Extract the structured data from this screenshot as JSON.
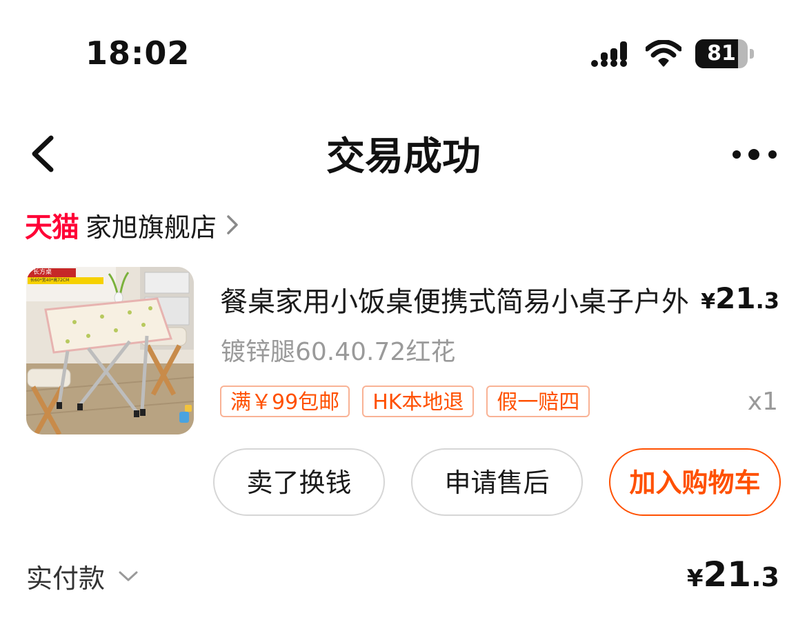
{
  "status_bar": {
    "time": "18:02",
    "battery": "81",
    "battery_level": 0.81
  },
  "nav": {
    "title": "交易成功",
    "back_icon": "chevron-left-icon",
    "more_icon": "more-dots-icon"
  },
  "store": {
    "platform": "天猫",
    "name": "家旭旗舰店",
    "platform_color": "#ff0036"
  },
  "product": {
    "thumbnail_label": "长方桌",
    "thumbnail_dimensions": "长60*宽40*高72CM",
    "title": "餐桌家用小饭桌便携式简易小桌子户外",
    "price_symbol": "¥",
    "price_int": "21",
    "price_dec": ".3",
    "spec": "镀锌腿60.40.72红花",
    "tags": [
      "满￥99包邮",
      "HK本地退",
      "假一赔四"
    ],
    "quantity": "x1"
  },
  "actions": {
    "sell_label": "卖了换钱",
    "after_sale_label": "申请售后",
    "add_cart_label": "加入购物车"
  },
  "payment": {
    "label": "实付款",
    "price_symbol": "¥",
    "price_int": "21",
    "price_dec": ".3"
  },
  "colors": {
    "accent": "#ff5000",
    "tag_border": "#f9b295",
    "muted_text": "#9a9a9a"
  }
}
